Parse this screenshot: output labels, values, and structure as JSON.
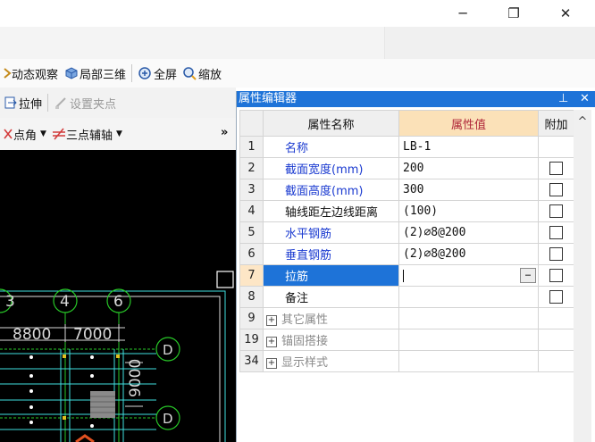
{
  "window": {
    "minimize_icon": "─",
    "maximize_icon": "❐",
    "close_icon": "✕"
  },
  "toolbar1": {
    "dynamic_view": "动态观察",
    "local_3d": "局部三维",
    "fullscreen": "全屏",
    "zoom": "缩放"
  },
  "toolbar2": {
    "stretch": "拉伸",
    "set_grip": "设置夹点"
  },
  "toolbar3": {
    "point_angle": "点角",
    "three_point_axis": "三点辅轴",
    "more": "»"
  },
  "canvas": {
    "axis_labels": [
      "3",
      "4",
      "6"
    ],
    "dimensions": [
      "8800",
      "7000",
      "9000"
    ],
    "row_marker": "D"
  },
  "property_editor": {
    "title": "属性编辑器",
    "pin_icon": "📌",
    "close_icon": "✕",
    "columns": {
      "name": "属性名称",
      "value": "属性值",
      "attach": "附加"
    },
    "rows": [
      {
        "num": "1",
        "name": "名称",
        "value": "LB-1"
      },
      {
        "num": "2",
        "name": "截面宽度(mm)",
        "value": "200"
      },
      {
        "num": "3",
        "name": "截面高度(mm)",
        "value": "300"
      },
      {
        "num": "4",
        "name": "轴线距左边线距离",
        "value": "(100)"
      },
      {
        "num": "5",
        "name": "水平钢筋",
        "value": "(2)⌀8@200"
      },
      {
        "num": "6",
        "name": "垂直钢筋",
        "value": "(2)⌀8@200"
      },
      {
        "num": "7",
        "name": "拉筋",
        "value": ""
      },
      {
        "num": "8",
        "name": "备注",
        "value": ""
      }
    ],
    "groups": [
      {
        "num": "9",
        "name": "其它属性"
      },
      {
        "num": "19",
        "name": "锚固搭接"
      },
      {
        "num": "34",
        "name": "显示样式"
      }
    ],
    "ellipsis": "…",
    "scroll_up": "^"
  },
  "colors": {
    "accent": "#1e73d8",
    "value_header": "#fbe1b8",
    "canvas_bg": "#000000"
  }
}
